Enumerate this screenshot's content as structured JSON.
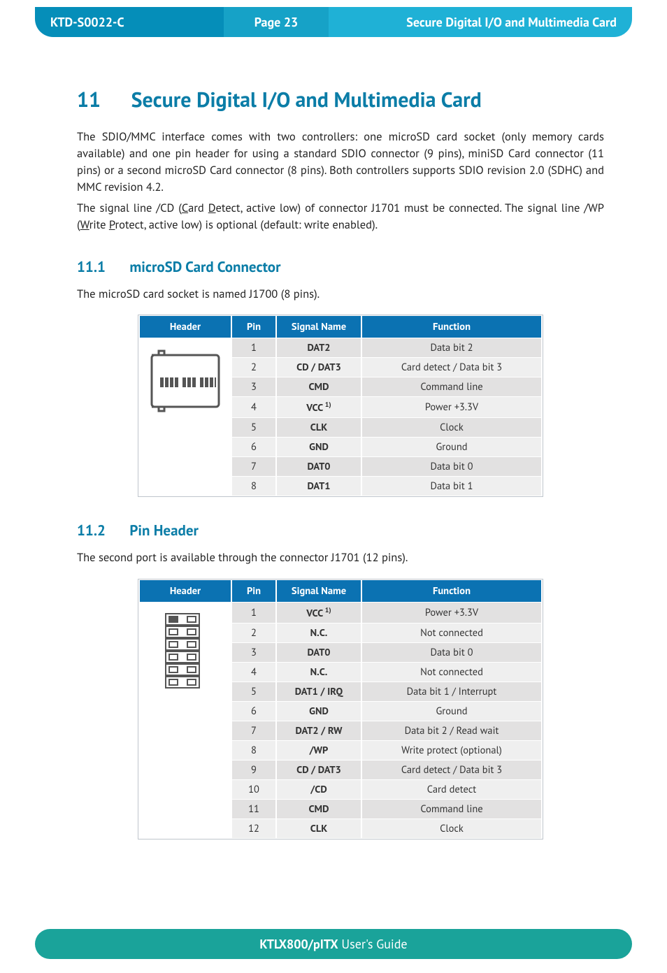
{
  "header": {
    "doc_code": "KTD-S0022-C",
    "page_label": "Page 23",
    "chapter_title": "Secure Digital I/O and Multimedia Card"
  },
  "chapter": {
    "number": "11",
    "title": "Secure Digital I/O and Multimedia Card"
  },
  "intro": {
    "p1": "The SDIO/MMC interface comes with two controllers: one microSD card socket (only memory cards available) and one pin header for using a standard SDIO connector (9 pins), miniSD Card connector (11 pins) or a second microSD Card connector (8 pins). Both controllers supports SDIO revision 2.0 (SDHC) and MMC revision 4.2.",
    "p2_a": "The signal line /CD (",
    "p2_u1": "C",
    "p2_b": "ard ",
    "p2_u2": "D",
    "p2_c": "etect, active low) of connector J1701 must be connected. The signal line /WP (",
    "p2_u3": "W",
    "p2_d": "rite ",
    "p2_u4": "P",
    "p2_e": "rotect, active low) is optional (default: write enabled)."
  },
  "sec11_1": {
    "number": "11.1",
    "title": "microSD Card Connector",
    "lead": "The microSD card socket is named J1700 (8 pins)."
  },
  "table_cols": {
    "c1": "Header",
    "c2": "Pin",
    "c3": "Signal Name",
    "c4": "Function"
  },
  "table1": [
    {
      "pin": "1",
      "sig": "DAT2",
      "fn": "Data bit 2",
      "sup": ""
    },
    {
      "pin": "2",
      "sig": "CD / DAT3",
      "fn": "Card detect / Data bit 3",
      "sup": ""
    },
    {
      "pin": "3",
      "sig": "CMD",
      "fn": "Command line",
      "sup": ""
    },
    {
      "pin": "4",
      "sig": "VCC",
      "fn": "Power +3.3V",
      "sup": "1)"
    },
    {
      "pin": "5",
      "sig": "CLK",
      "fn": "Clock",
      "sup": ""
    },
    {
      "pin": "6",
      "sig": "GND",
      "fn": "Ground",
      "sup": ""
    },
    {
      "pin": "7",
      "sig": "DAT0",
      "fn": "Data bit 0",
      "sup": ""
    },
    {
      "pin": "8",
      "sig": "DAT1",
      "fn": "Data bit 1",
      "sup": ""
    }
  ],
  "sec11_2": {
    "number": "11.2",
    "title": "Pin Header",
    "lead": "The second port is available through the connector J1701 (12 pins)."
  },
  "table2": [
    {
      "pin": "1",
      "sig": "VCC",
      "fn": "Power +3.3V",
      "sup": "1)"
    },
    {
      "pin": "2",
      "sig": "N.C.",
      "fn": "Not connected",
      "sup": ""
    },
    {
      "pin": "3",
      "sig": "DAT0",
      "fn": "Data bit 0",
      "sup": ""
    },
    {
      "pin": "4",
      "sig": "N.C.",
      "fn": "Not connected",
      "sup": ""
    },
    {
      "pin": "5",
      "sig": "DAT1 / IRQ",
      "fn": "Data bit 1 / Interrupt",
      "sup": ""
    },
    {
      "pin": "6",
      "sig": "GND",
      "fn": "Ground",
      "sup": ""
    },
    {
      "pin": "7",
      "sig": "DAT2 / RW",
      "fn": "Data bit 2 / Read wait",
      "sup": ""
    },
    {
      "pin": "8",
      "sig": "/WP",
      "fn": "Write protect (optional)",
      "sup": ""
    },
    {
      "pin": "9",
      "sig": "CD / DAT3",
      "fn": "Card detect / Data bit 3",
      "sup": ""
    },
    {
      "pin": "10",
      "sig": "/CD",
      "fn": "Card detect",
      "sup": ""
    },
    {
      "pin": "11",
      "sig": "CMD",
      "fn": "Command line",
      "sup": ""
    },
    {
      "pin": "12",
      "sig": "CLK",
      "fn": "Clock",
      "sup": ""
    }
  ],
  "footer": {
    "product": "KTLX800/pITX",
    "tail": " User's Guide"
  }
}
